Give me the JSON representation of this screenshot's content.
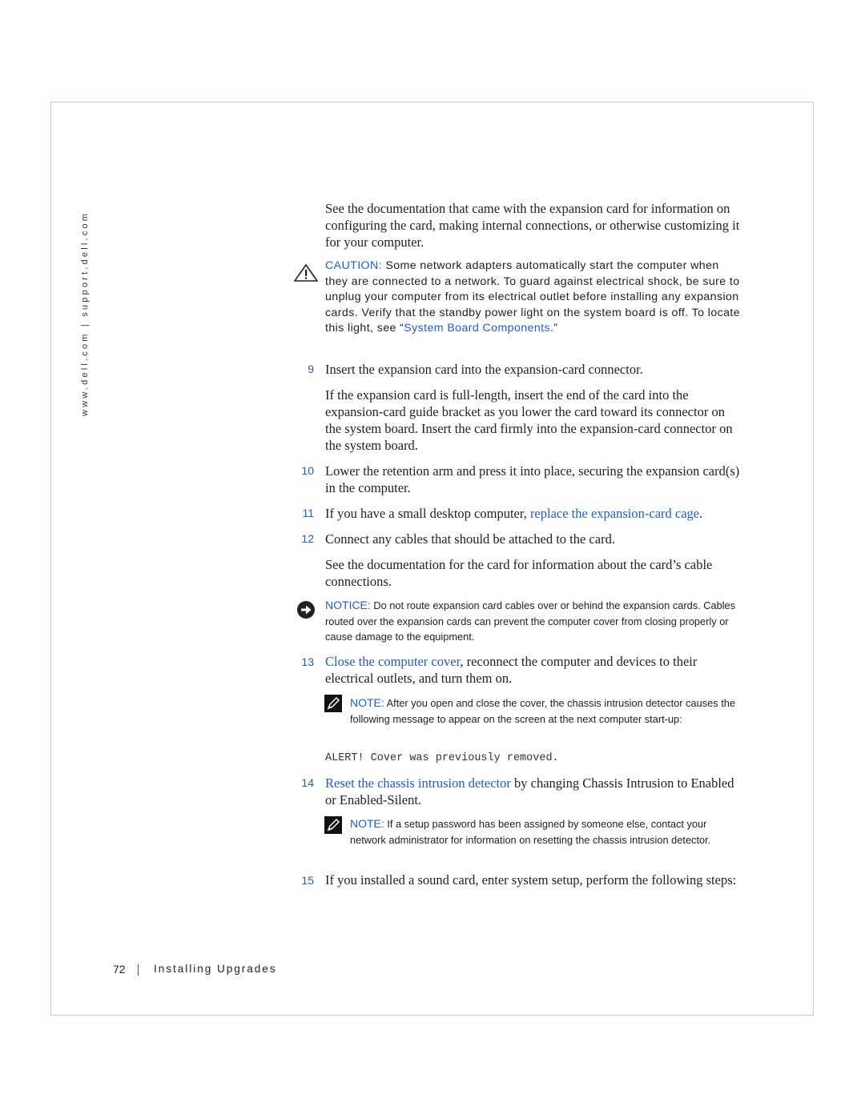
{
  "sidebar": {
    "url_text": "www.dell.com | support.dell.com"
  },
  "content": {
    "intro": "See the documentation that came with the expansion card for information on configuring the card, making internal connections, or otherwise customizing it for your computer.",
    "caution": {
      "label": "CAUTION:",
      "text": " Some network adapters automatically start the computer when they are connected to a network. To guard against electrical shock, be sure to unplug your computer from its electrical outlet before installing any expansion cards. Verify that the standby power light on the system board is off. To locate this light, see “",
      "link": "System Board Components",
      "suffix": ".”"
    },
    "steps": [
      {
        "num": "9",
        "text": "Insert the expansion card into the expansion-card connector."
      },
      {
        "num": "10",
        "text": "Lower the retention arm and press it into place, securing the expansion card(s) in the computer."
      },
      {
        "num": "11",
        "text": "If you have a small desktop computer, ",
        "link": "replace the expansion-card cage",
        "suffix": "."
      },
      {
        "num": "12",
        "text": "Connect any cables that should be attached to the card."
      },
      {
        "num": "13",
        "link": "Close the computer cover",
        "text": ", reconnect the computer and devices to their electrical outlets, and turn them on."
      },
      {
        "num": "14",
        "link": "Reset the chassis intrusion detector",
        "text": " by changing Chassis Intrusion to Enabled or Enabled-Silent."
      },
      {
        "num": "15",
        "text": "If you installed a sound card, enter system setup, perform the following steps:"
      }
    ],
    "step9_detail": "If the expansion card is full-length, insert the end of the card into the expansion-card guide bracket as you lower the card toward its connector on the system board. Insert the card firmly into the expansion-card connector on the system board.",
    "step12_detail": "See the documentation for the card for information about the card’s cable connections.",
    "notice": {
      "label": "NOTICE:",
      "text": " Do not route expansion card cables over or behind the expansion cards. Cables routed over the expansion cards can prevent the computer cover from closing properly or cause damage to the equipment."
    },
    "note1": {
      "label": "NOTE:",
      "text": " After you open and close the cover, the chassis intrusion detector causes the following message to appear on the screen at the next computer start-up:"
    },
    "alert_message": "ALERT! Cover was previously removed.",
    "note2": {
      "label": "NOTE:",
      "text": " If a setup password has been assigned by someone else, contact your network administrator for information on resetting the chassis intrusion detector."
    }
  },
  "footer": {
    "page_number": "72",
    "section_title": "Installing Upgrades"
  }
}
